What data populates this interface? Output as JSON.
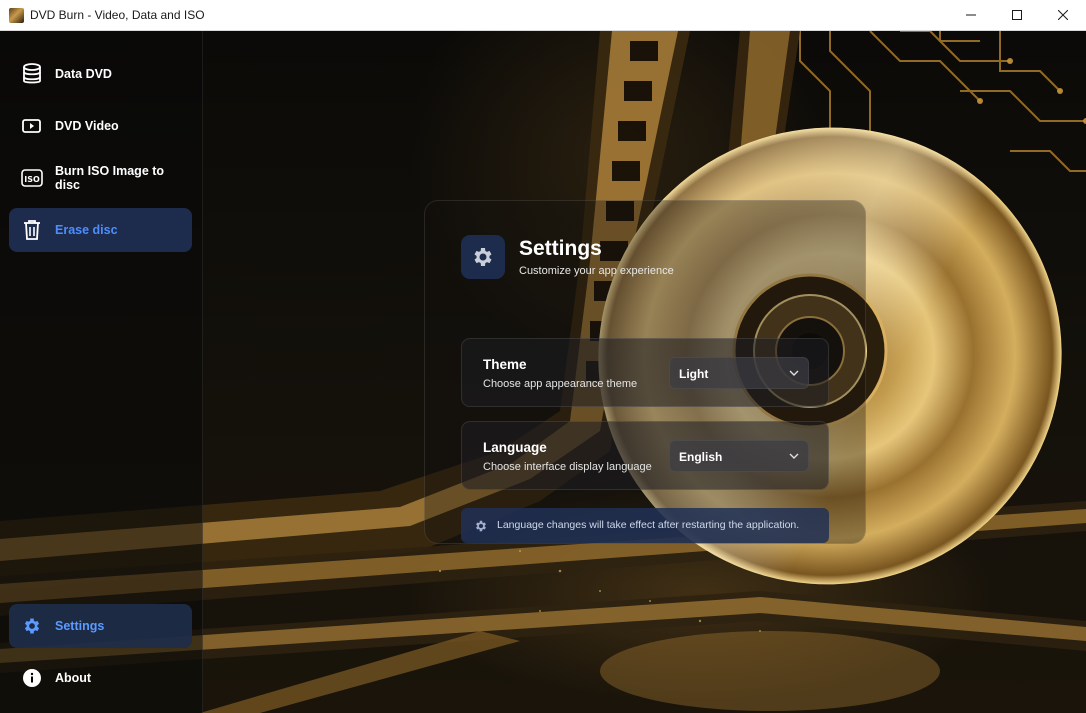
{
  "window": {
    "title": "DVD Burn - Video, Data and ISO",
    "controls": [
      "minimize-icon",
      "maximize-icon",
      "close-icon"
    ]
  },
  "sidebar": {
    "items": [
      {
        "label": "Data DVD",
        "icon": "database-icon",
        "active": false
      },
      {
        "label": "DVD Video",
        "icon": "video-icon",
        "active": false
      },
      {
        "label": "Burn ISO Image to disc",
        "icon": "iso-icon",
        "active": false
      },
      {
        "label": "Erase disc",
        "icon": "trash-icon",
        "active": true
      }
    ],
    "footer_items": [
      {
        "label": "Settings",
        "icon": "gear-icon",
        "active": true
      },
      {
        "label": "About",
        "icon": "info-icon",
        "active": false
      }
    ]
  },
  "settings": {
    "title": "Settings",
    "subtitle": "Customize your app experience",
    "theme": {
      "title": "Theme",
      "description": "Choose app appearance theme",
      "value": "Light"
    },
    "language": {
      "title": "Language",
      "description": "Choose interface display language",
      "value": "English"
    },
    "notice": "Language changes will take effect after restarting the application."
  },
  "colors": {
    "accent": "#4d8dff",
    "active_nav_bg": "#203052",
    "titlebar_bg": "#ffffff"
  }
}
